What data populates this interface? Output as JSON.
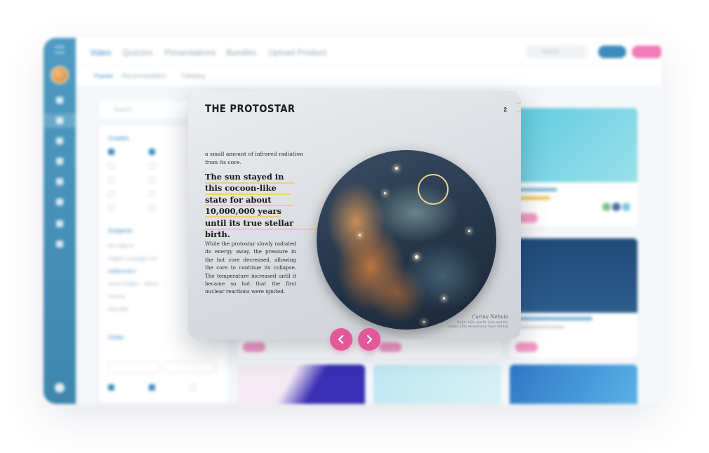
{
  "app": {
    "nav_tabs": [
      "Video",
      "Quizzes",
      "Presentations",
      "Bundles",
      "Upload Product"
    ],
    "search_placeholder": "Search",
    "sub_tabs": [
      "Popular",
      "Recommendation",
      "Following"
    ],
    "filter_search_placeholder": "Search",
    "filter_headings": [
      "Grades",
      "Subjects",
      "Order"
    ],
    "subjects": [
      "All Subjects",
      "English Language Arts",
      "Mathematics",
      "Social Studies - History",
      "Science",
      "Specialty"
    ]
  },
  "book": {
    "title": "THE PROTOSTAR",
    "page_number": "2",
    "intro": "a small amount of infrared radiation from its core.",
    "quote": "The sun stayed in this cocoon-like state for about 10,000,000 years until its true stellar birth.",
    "body": "While the protostar slowly radiated its energy away, the pressure in the hot core decreased, allowing the core to continue its collapse. The temperature increased until it became so hot that the first nuclear reactions were ignited.",
    "image_caption_title": "Carina Nebula",
    "image_caption_credit": "NASA, ESA, and M. Livio and the Hubble 20th Anniversary Team (STScI)",
    "image_icon": "nebula-image"
  },
  "controls": {
    "prev_icon": "chevron-left-icon",
    "next_icon": "chevron-right-icon"
  },
  "colors": {
    "accent_blue": "#3e8fc0",
    "accent_pink": "#e2589a",
    "highlight_yellow": "#f0cf72"
  }
}
